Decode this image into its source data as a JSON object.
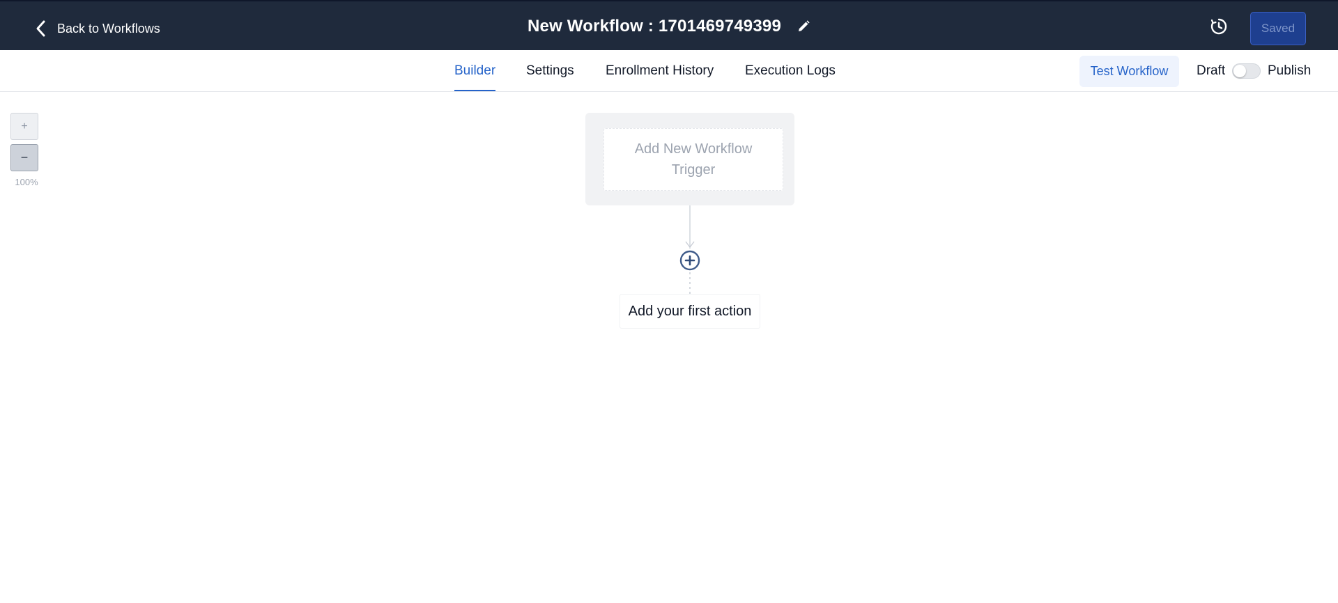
{
  "header": {
    "back_label": "Back to Workflows",
    "title": "New Workflow : 1701469749399",
    "saved_label": "Saved"
  },
  "tabs": [
    {
      "label": "Builder",
      "active": true
    },
    {
      "label": "Settings",
      "active": false
    },
    {
      "label": "Enrollment History",
      "active": false
    },
    {
      "label": "Execution Logs",
      "active": false
    }
  ],
  "toolbar": {
    "test_label": "Test Workflow",
    "draft_label": "Draft",
    "publish_label": "Publish",
    "publish_toggle_on": false
  },
  "zoom": {
    "in_symbol": "+",
    "out_symbol": "−",
    "level": "100%"
  },
  "canvas": {
    "trigger_label": "Add New Workflow Trigger",
    "first_action_label": "Add your first action"
  },
  "colors": {
    "header_bg": "#1f2a3c",
    "accent": "#2563c9",
    "saved_bg": "#1e3f8f"
  },
  "icons": {
    "back": "chevron-left-icon",
    "edit": "pencil-icon",
    "history": "history-clock-icon",
    "add_step": "plus-circle-icon"
  }
}
